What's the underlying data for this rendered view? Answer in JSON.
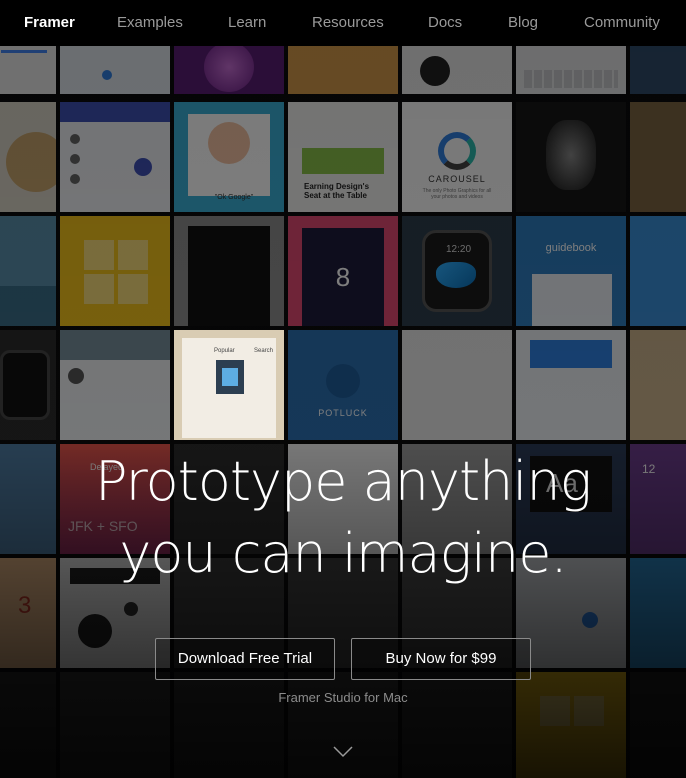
{
  "nav": {
    "brand": "Framer",
    "items": [
      "Examples",
      "Learn",
      "Resources",
      "Docs",
      "Blog",
      "Community"
    ]
  },
  "hero": {
    "line1": "Prototype anything",
    "line2": "you can imagine.",
    "primary_button": "Download Free Trial",
    "secondary_button": "Buy Now for $99",
    "subtitle": "Framer Studio for Mac"
  },
  "tiles": {
    "carousel_title": "CAROUSEL",
    "carousel_caption": "The only Photo Graphics for all your photos and videos",
    "article_title": "Earning Design's Seat at the Table",
    "watch_time": "12:20",
    "level_number": "8",
    "app_name": "guidebook",
    "potluck": "POTLUCK",
    "delayed": "Delayed",
    "route": "JFK + SFO",
    "font_sample": "Aa",
    "ok_google": "\"Ok Google\"",
    "popular": "Popular",
    "search": "Search",
    "number_3": "3",
    "number_12": "12"
  },
  "colors": {
    "nav_bg": "#000000",
    "nav_active": "#ffffff",
    "nav_inactive": "#9a9a9a",
    "button_border": "#8a8a8a",
    "accent_blue": "#2f7fe0",
    "accent_yellow": "#f2c21a"
  }
}
